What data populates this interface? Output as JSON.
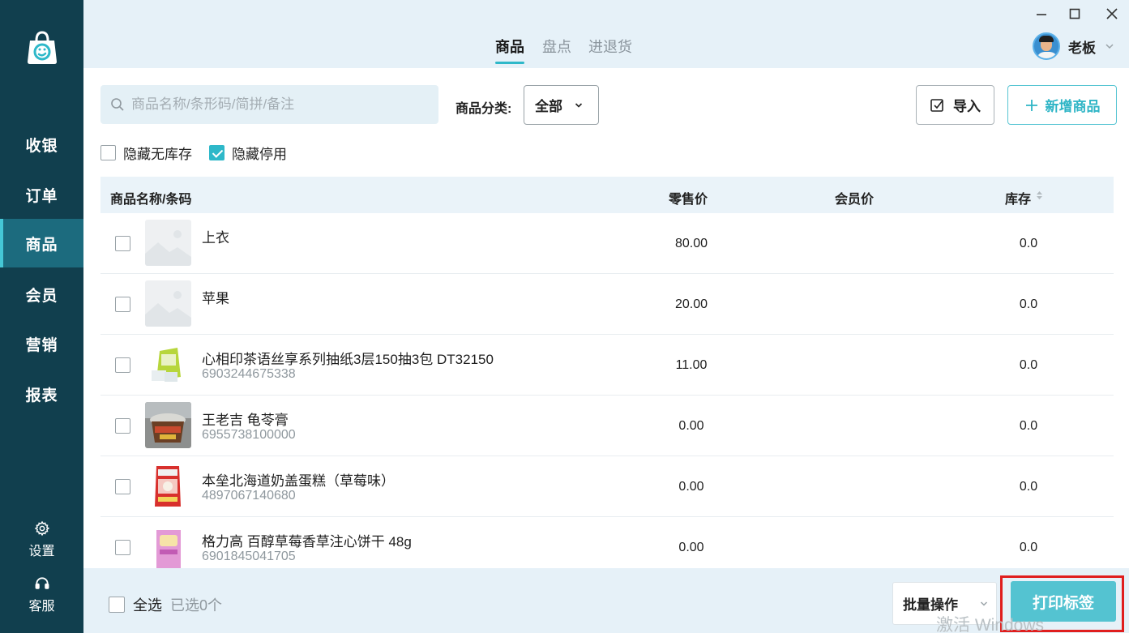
{
  "sidebar": {
    "items": [
      {
        "label": "收银"
      },
      {
        "label": "订单"
      },
      {
        "label": "商品"
      },
      {
        "label": "会员"
      },
      {
        "label": "营销"
      },
      {
        "label": "报表"
      }
    ],
    "active_index": 2,
    "settings_label": "设置",
    "support_label": "客服"
  },
  "header": {
    "tabs": [
      {
        "label": "商品"
      },
      {
        "label": "盘点"
      },
      {
        "label": "进退货"
      }
    ],
    "active_tab": 0,
    "user_name": "老板"
  },
  "toolbar": {
    "search_placeholder": "商品名称/条形码/简拼/备注",
    "category_label": "商品分类:",
    "category_value": "全部",
    "import_label": "导入",
    "add_label": "新增商品"
  },
  "filters": [
    {
      "label": "隐藏无库存",
      "checked": false
    },
    {
      "label": "隐藏停用",
      "checked": true
    }
  ],
  "table": {
    "columns": {
      "name": "商品名称/条码",
      "retail_price": "零售价",
      "member_price": "会员价",
      "stock": "库存"
    },
    "rows": [
      {
        "name": "上衣",
        "code": "",
        "retail_price": "80.00",
        "member_price": "",
        "stock": "0.0",
        "image": "placeholder"
      },
      {
        "name": "苹果",
        "code": "",
        "retail_price": "20.00",
        "member_price": "",
        "stock": "0.0",
        "image": "placeholder"
      },
      {
        "name": "心相印茶语丝享系列抽纸3层150抽3包 DT32150",
        "code": "6903244675338",
        "retail_price": "11.00",
        "member_price": "",
        "stock": "0.0",
        "image": "tissue-pack"
      },
      {
        "name": "王老吉 龟苓膏",
        "code": "6955738100000",
        "retail_price": "0.00",
        "member_price": "",
        "stock": "0.0",
        "image": "jelly-cup"
      },
      {
        "name": "本垒北海道奶盖蛋糕（草莓味）",
        "code": "4897067140680",
        "retail_price": "0.00",
        "member_price": "",
        "stock": "0.0",
        "image": "cake-pack"
      },
      {
        "name": "格力高 百醇草莓香草注心饼干 48g",
        "code": "6901845041705",
        "retail_price": "0.00",
        "member_price": "",
        "stock": "0.0",
        "image": "biscuit-box"
      }
    ]
  },
  "footer": {
    "select_all_label": "全选",
    "selected_count_text": "已选0个",
    "batch_label": "批量操作",
    "print_label": "打印标签",
    "watermark": "激活 Windows"
  },
  "colors": {
    "sidebar_bg": "#113f4e",
    "sidebar_active": "#1c6b7e",
    "accent": "#2eb8c9",
    "print_button": "#54c3d1",
    "highlight": "#e01e1e"
  }
}
